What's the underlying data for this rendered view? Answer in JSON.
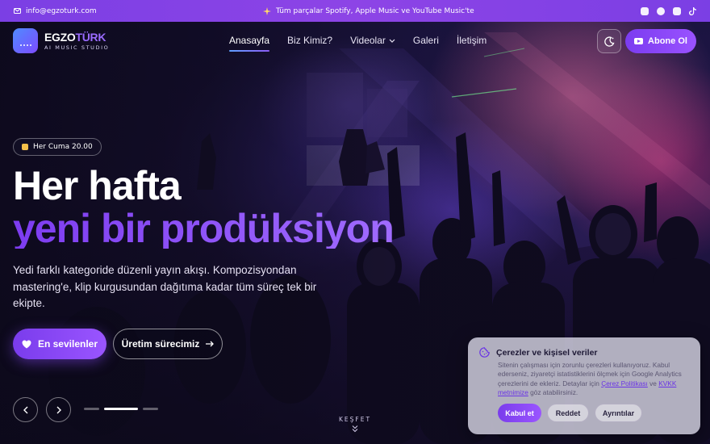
{
  "topbar": {
    "email": "info@egzoturk.com",
    "announcement": "Tüm parçalar Spotify, Apple Music ve YouTube Music'te",
    "socials": [
      "youtube-icon",
      "spotify-icon",
      "instagram-icon",
      "tiktok-icon"
    ]
  },
  "brand": {
    "name_part1": "EGZO",
    "name_part2": "TÜRK",
    "tagline": "AI MUSIC STUDIO"
  },
  "nav": {
    "items": [
      {
        "label": "Anasayfa",
        "active": true
      },
      {
        "label": "Biz Kimiz?",
        "active": false
      },
      {
        "label": "Videolar",
        "active": false,
        "dropdown": true
      },
      {
        "label": "Galeri",
        "active": false
      },
      {
        "label": "İletişim",
        "active": false
      }
    ],
    "subscribe_label": "Abone Ol"
  },
  "hero": {
    "schedule_chip": "Her Cuma 20.00",
    "title_line1": "Her hafta",
    "title_line2": "yeni bir prodüksiyon",
    "description": "Yedi farklı kategoride düzenli yayın akışı. Kompozisyondan mastering'e, klip kurgusundan dağıtıma kadar tüm süreç tek bir ekipte.",
    "primary_cta": "En sevilenler",
    "secondary_cta": "Üretim sürecimiz",
    "slides": {
      "count": 3,
      "active_index": 1
    },
    "explore_label": "KEŞFET"
  },
  "cookie": {
    "title": "Çerezler ve kişisel veriler",
    "text_before": "Sitenin çalışması için zorunlu çerezleri kullanıyoruz. Kabul ederseniz, ziyaretçi istatistiklerini ölçmek için Google Analytics çerezlerini de ekleriz. Detaylar için ",
    "link1": "Çerez Politikası",
    "text_mid": " ve ",
    "link2": "KVKK metnimize",
    "text_after": " göz atabilirsiniz.",
    "accept_label": "Kabul et",
    "reject_label": "Reddet",
    "details_label": "Ayrıntılar"
  },
  "colors": {
    "accent": "#8b4cf6",
    "topbar": "#7b3fe4",
    "link": "#6a33e6",
    "schedule_icon": "#f5c04a"
  }
}
